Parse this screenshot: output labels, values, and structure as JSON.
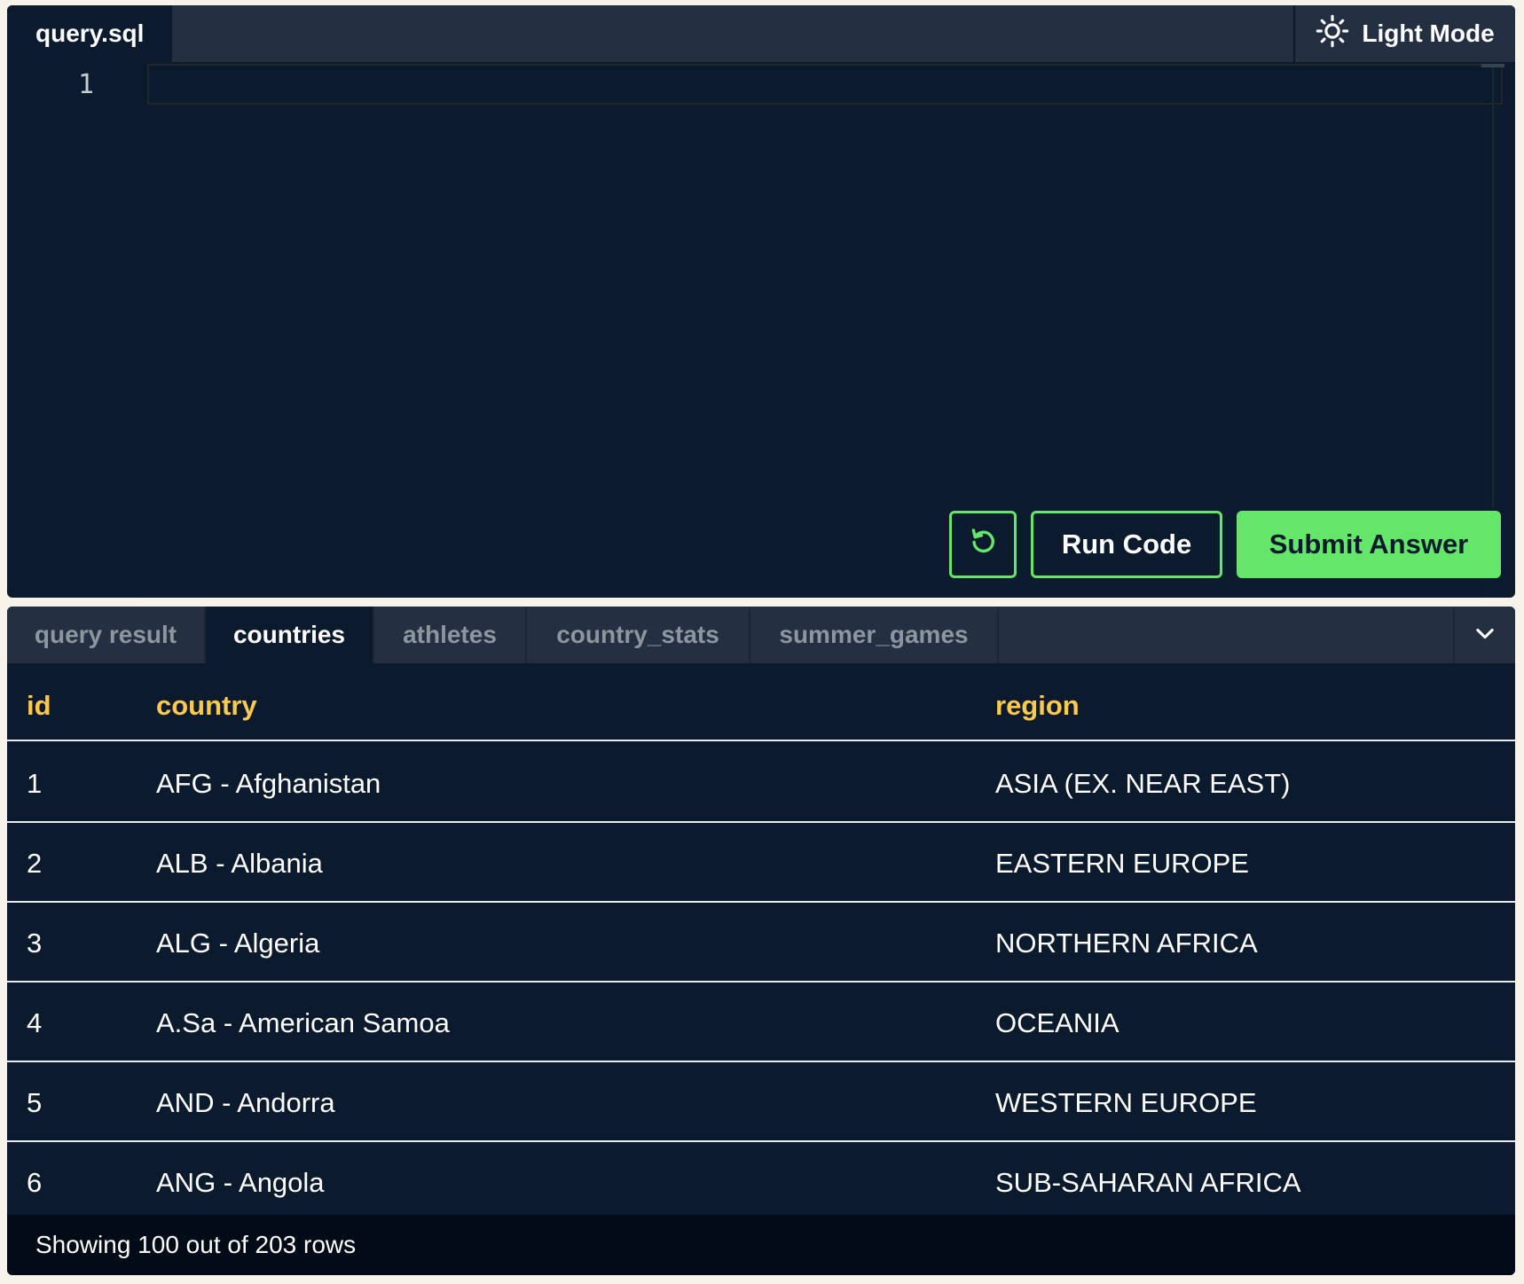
{
  "editor": {
    "file_tab": "query.sql",
    "light_mode_label": "Light Mode",
    "line_numbers": [
      "1"
    ],
    "code": "",
    "run_label": "Run Code",
    "submit_label": "Submit Answer",
    "accent_color": "#65e56a"
  },
  "results": {
    "tabs": [
      {
        "label": "query result",
        "active": false
      },
      {
        "label": "countries",
        "active": true
      },
      {
        "label": "athletes",
        "active": false
      },
      {
        "label": "country_stats",
        "active": false
      },
      {
        "label": "summer_games",
        "active": false
      }
    ],
    "columns": [
      "id",
      "country",
      "region"
    ],
    "rows": [
      {
        "id": "1",
        "country": "AFG - Afghanistan",
        "region": "ASIA (EX. NEAR EAST)"
      },
      {
        "id": "2",
        "country": "ALB - Albania",
        "region": "EASTERN EUROPE"
      },
      {
        "id": "3",
        "country": "ALG - Algeria",
        "region": "NORTHERN AFRICA"
      },
      {
        "id": "4",
        "country": "A.Sa - American Samoa",
        "region": "OCEANIA"
      },
      {
        "id": "5",
        "country": "AND - Andorra",
        "region": "WESTERN EUROPE"
      },
      {
        "id": "6",
        "country": "ANG - Angola",
        "region": "SUB-SAHARAN AFRICA"
      }
    ],
    "footer": "Showing 100 out of 203 rows",
    "header_color": "#ffc94d"
  },
  "icons": {
    "theme": "sun-icon",
    "reset": "reset-icon",
    "collapse": "chevron-down-icon"
  }
}
